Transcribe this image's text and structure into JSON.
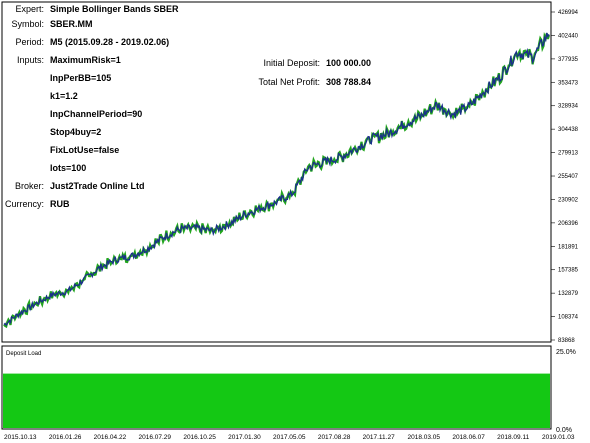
{
  "report": {
    "expert": {
      "label": "Expert:",
      "value": "Simple Bollinger Bands SBER"
    },
    "symbol": {
      "label": "Symbol:",
      "value": "SBER.MM"
    },
    "period": {
      "label": "Period:",
      "value": "M5 (2015.09.28 - 2019.02.06)"
    },
    "inputs": {
      "label": "Inputs:",
      "values": [
        "MaximumRisk=1",
        "InpPerBB=105",
        "k1=1.2",
        "InpChannelPeriod=90",
        "Stop4buy=2",
        "FixLotUse=false",
        "lots=100"
      ]
    },
    "broker": {
      "label": "Broker:",
      "value": "Just2Trade Online Ltd"
    },
    "currency": {
      "label": "Currency:",
      "value": "RUB"
    },
    "initial_deposit": {
      "label": "Initial Deposit:",
      "value": "100 000.00"
    },
    "net_profit": {
      "label": "Total Net Profit:",
      "value": "308 788.84"
    }
  },
  "colors": {
    "equity": "#1a2f8a",
    "balance": "#22a51e",
    "deposit_load": "#14c814"
  },
  "chart_data": [
    {
      "type": "line",
      "title": "",
      "series": [],
      "x": [
        "2015.10.13",
        "2016.01.26",
        "2016.04.22",
        "2016.07.29",
        "2016.10.25",
        "2017.01.30",
        "2017.05.05",
        "2017.08.28",
        "2017.11.27",
        "2018.03.05",
        "2018.06.07",
        "2018.09.11",
        "2019.01.03"
      ],
      "y_values": [
        100000,
        112000,
        122000,
        131000,
        135000,
        147000,
        160000,
        168000,
        172000,
        180000,
        192000,
        200000,
        201000,
        198000,
        205000,
        215000,
        222000,
        228000,
        237000,
        265000,
        270000,
        275000,
        285000,
        295000,
        300000,
        310000,
        318000,
        330000,
        320000,
        328000,
        345000,
        360000,
        385000,
        380000,
        405000
      ],
      "y_ticks": [
        "426994",
        "402440",
        "377935",
        "353473",
        "328934",
        "304438",
        "279913",
        "255407",
        "230902",
        "206396",
        "181891",
        "157385",
        "132879",
        "108374",
        "83868"
      ],
      "ylim": [
        83868,
        426994
      ],
      "grid": false
    },
    {
      "type": "area",
      "title": "Deposit Load",
      "y_ticks": [
        "25.0%",
        "0.0%"
      ],
      "ylim": [
        0,
        25
      ],
      "level": 17
    }
  ]
}
